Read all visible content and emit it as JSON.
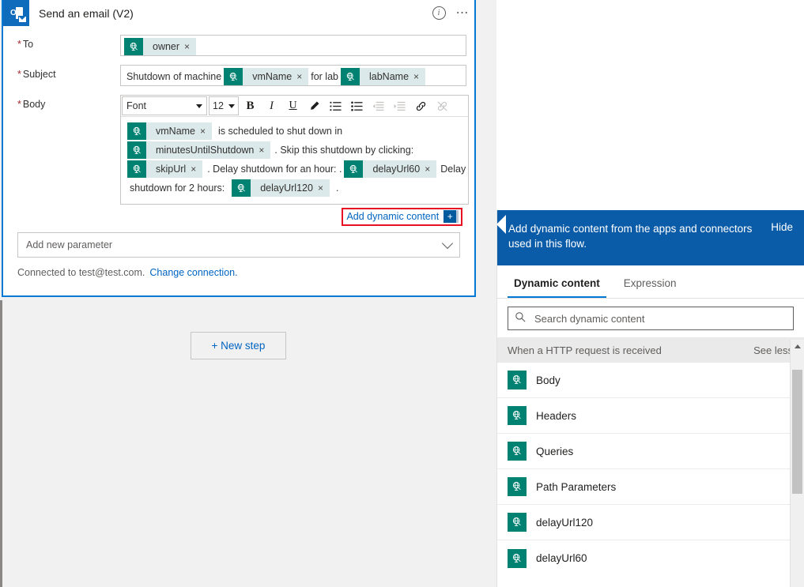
{
  "card": {
    "app_icon": "outlook-icon",
    "title": "Send an email (V2)",
    "info_icon": "info-icon",
    "more_icon": "ellipsis-icon",
    "fields": {
      "to": {
        "label": "To",
        "required_mark": "*",
        "tokens": [
          {
            "label": "owner",
            "remove": "×",
            "icon": "http-request-icon"
          }
        ]
      },
      "subject": {
        "label": "Subject",
        "required_mark": "*",
        "parts": [
          {
            "type": "text",
            "value": "Shutdown of machine"
          },
          {
            "type": "token",
            "label": "vmName",
            "remove": "×",
            "icon": "http-request-icon"
          },
          {
            "type": "text",
            "value": "for lab"
          },
          {
            "type": "token",
            "label": "labName",
            "remove": "×",
            "icon": "http-request-icon"
          }
        ]
      },
      "body": {
        "label": "Body",
        "required_mark": "*",
        "toolbar": {
          "font_name": "Font",
          "font_size": "12",
          "bold": "B",
          "italic": "I",
          "underline": "U",
          "font_color": "pen-icon",
          "numbered_list": "numbered-list-icon",
          "bulleted_list": "bulleted-list-icon",
          "decrease_indent": "decrease-indent-icon",
          "increase_indent": "increase-indent-icon",
          "insert_link": "link-icon",
          "remove_link": "unlink-icon"
        },
        "lines": [
          [
            {
              "type": "token",
              "label": "vmName",
              "remove": "×",
              "icon": "http-request-icon"
            },
            {
              "type": "text",
              "value": "is scheduled to shut down in"
            }
          ],
          [
            {
              "type": "token",
              "label": "minutesUntilShutdown",
              "remove": "×",
              "icon": "http-request-icon"
            },
            {
              "type": "text",
              "value": ". Skip this shutdown by clicking:"
            }
          ],
          [
            {
              "type": "token",
              "label": "skipUrl",
              "remove": "×",
              "icon": "http-request-icon"
            },
            {
              "type": "text",
              "value": ". Delay shutdown for an hour: ."
            },
            {
              "type": "token",
              "label": "delayUrl60",
              "remove": "×",
              "icon": "http-request-icon"
            },
            {
              "type": "text",
              "value": "Delay"
            }
          ],
          [
            {
              "type": "text",
              "value": "shutdown for 2 hours:"
            },
            {
              "type": "token",
              "label": "delayUrl120",
              "remove": "×",
              "icon": "http-request-icon"
            },
            {
              "type": "text",
              "value": "."
            }
          ]
        ]
      }
    },
    "add_dynamic_content": {
      "label": "Add dynamic content",
      "plus": "+",
      "highlight_color": "#e81123"
    },
    "add_new_parameter": "Add new parameter",
    "connection": {
      "text": "Connected to test@test.com.",
      "change_link": "Change connection."
    }
  },
  "canvas": {
    "new_step_button": "+ New step"
  },
  "panel": {
    "header_text": "Add dynamic content from the apps and connectors used in this flow.",
    "hide_label": "Hide",
    "tabs": [
      {
        "label": "Dynamic content",
        "active": true
      },
      {
        "label": "Expression",
        "active": false
      }
    ],
    "search": {
      "placeholder": "Search dynamic content",
      "value": "",
      "icon": "search-icon"
    },
    "group": {
      "title": "When a HTTP request is received",
      "toggle_label": "See less"
    },
    "items": [
      {
        "label": "Body",
        "icon": "http-request-icon"
      },
      {
        "label": "Headers",
        "icon": "http-request-icon"
      },
      {
        "label": "Queries",
        "icon": "http-request-icon"
      },
      {
        "label": "Path Parameters",
        "icon": "http-request-icon"
      },
      {
        "label": "delayUrl120",
        "icon": "http-request-icon"
      },
      {
        "label": "delayUrl60",
        "icon": "http-request-icon"
      }
    ],
    "scrollbar": {
      "up_arrow": "scroll-up-icon"
    }
  },
  "colors": {
    "accent_blue": "#0078d4",
    "panel_header_blue": "#0a5ca8",
    "token_teal": "#008272",
    "token_bg": "#dce9ea",
    "highlight_red": "#e81123",
    "canvas_gray": "#f1f1f1"
  }
}
